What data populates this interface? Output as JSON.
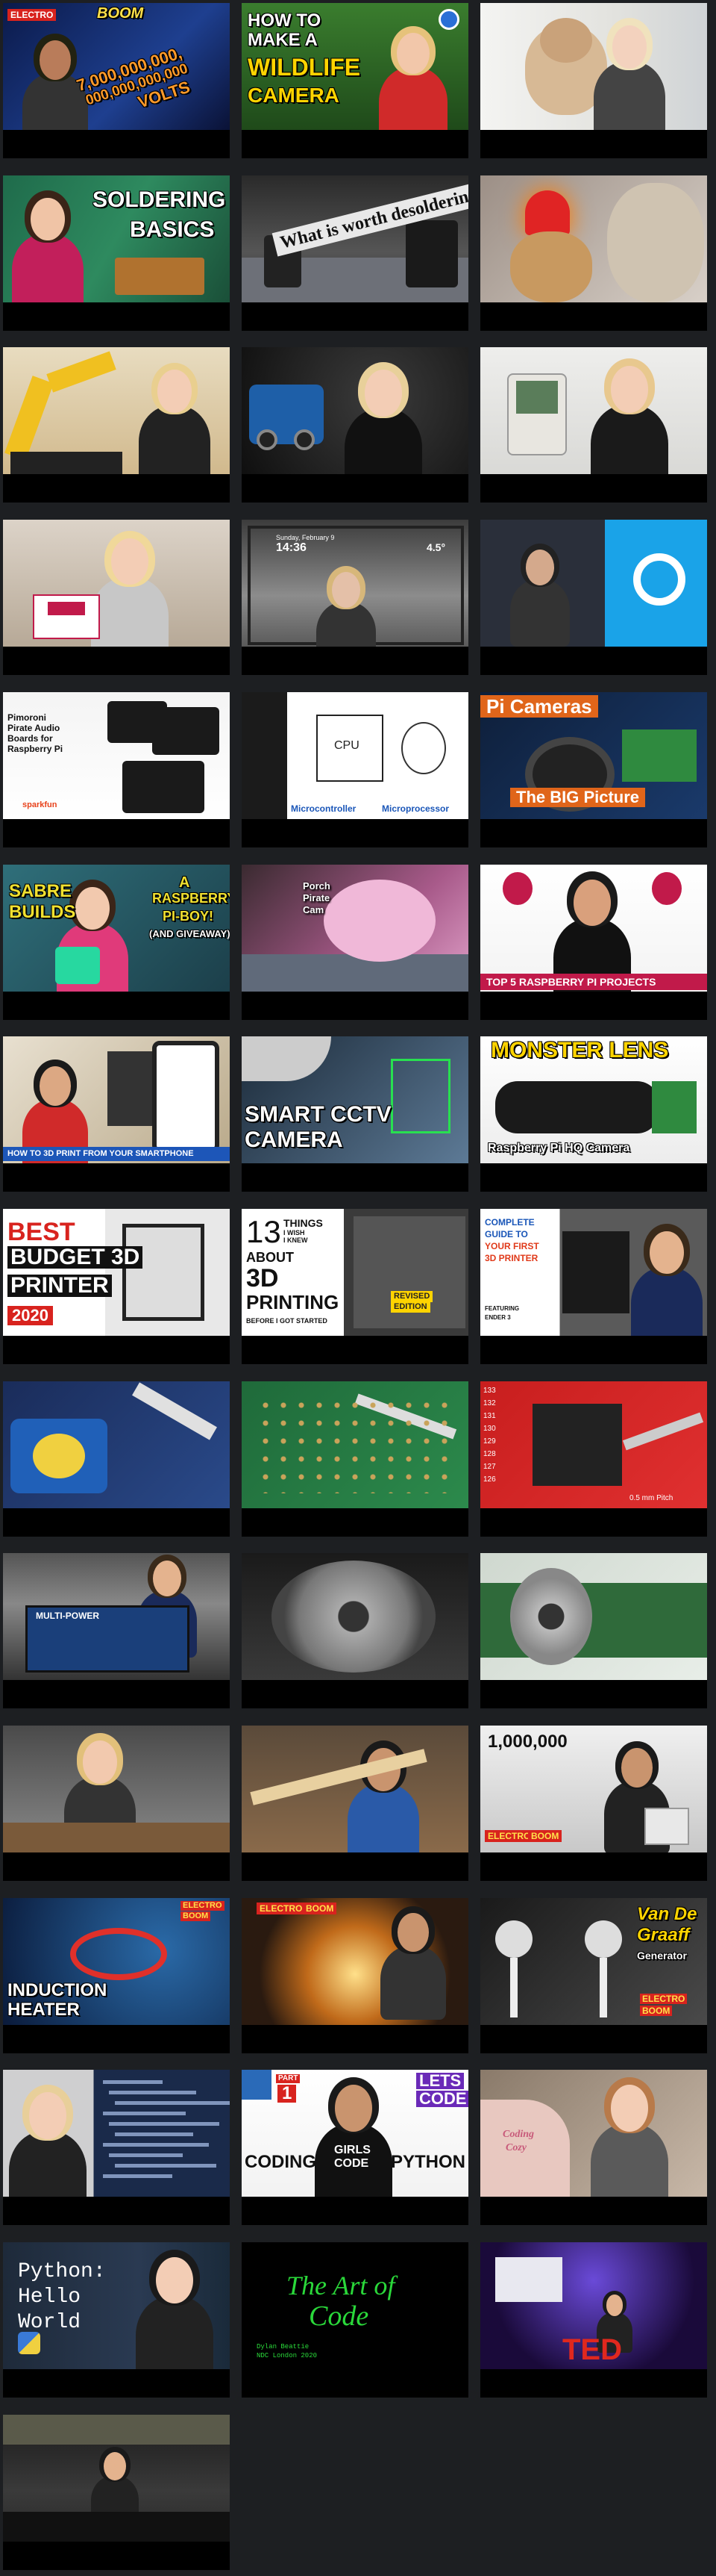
{
  "thumbnails": [
    {
      "name": "7000000000 volts",
      "lines": [
        "ELECTRO",
        "BOOM",
        "7,000,000,000,",
        "000,000,000,000",
        "VOLTS"
      ]
    },
    {
      "name": "wildlife camera",
      "lines": [
        "HOW TO",
        "MAKE A",
        "WILDLIFE",
        "CAMERA"
      ]
    },
    {
      "name": "woman with cat",
      "lines": []
    },
    {
      "name": "soldering basics",
      "lines": [
        "SOLDERING",
        "BASICS"
      ]
    },
    {
      "name": "desoldering",
      "lines": [
        "What is worth desoldering ?"
      ]
    },
    {
      "name": "alarm cat",
      "lines": []
    },
    {
      "name": "robot arm",
      "lines": []
    },
    {
      "name": "robot car",
      "lines": []
    },
    {
      "name": "handheld console",
      "lines": []
    },
    {
      "name": "raspberry pi box",
      "lines": []
    },
    {
      "name": "smart mirror",
      "lines": [
        "Sunday, February 9",
        "14:36",
        "4.5°"
      ]
    },
    {
      "name": "alexa",
      "lines": []
    },
    {
      "name": "pirate audio",
      "lines": [
        "Pimoroni",
        "Pirate Audio",
        "Boards for",
        "Raspberry Pi",
        "sparkfun"
      ]
    },
    {
      "name": "microcontroller vs microprocessor",
      "lines": [
        "CPU",
        "Microcontroller",
        "Microprocessor"
      ]
    },
    {
      "name": "pi cameras",
      "lines": [
        "Pi Cameras",
        "The BIG Picture"
      ]
    },
    {
      "name": "pi-boy",
      "lines": [
        "SABRE",
        "BUILDS",
        "A",
        "RASPBERRY",
        "PI-BOY!",
        "(AND GIVEAWAY)"
      ]
    },
    {
      "name": "porch pirate cam",
      "lines": [
        "Porch",
        "Pirate",
        "Cam"
      ]
    },
    {
      "name": "top 5 raspberry pi projects",
      "lines": [
        "TOP 5 RASPBERRY PI PROJECTS"
      ]
    },
    {
      "name": "3d print from smartphone",
      "lines": [
        "HOW TO 3D PRINT FROM YOUR SMARTPHONE"
      ]
    },
    {
      "name": "smart cctv camera",
      "lines": [
        "SMART CCTV",
        "CAMERA"
      ]
    },
    {
      "name": "monster lens",
      "lines": [
        "MONSTER LENS",
        "Raspberry Pi HQ Camera"
      ]
    },
    {
      "name": "best budget 3d printer",
      "lines": [
        "BEST",
        "BUDGET 3D",
        "PRINTER",
        "2020"
      ]
    },
    {
      "name": "13 things 3d printing",
      "lines": [
        "13",
        "THINGS",
        "I WISH",
        "I KNEW",
        "ABOUT",
        "3D",
        "PRINTING",
        "BEFORE I GOT STARTED",
        "REVISED",
        "EDITION"
      ]
    },
    {
      "name": "complete guide 3d printer",
      "lines": [
        "COMPLETE",
        "GUIDE TO",
        "YOUR FIRST",
        "3D PRINTER",
        "FEATURING",
        "ENDER 3"
      ]
    },
    {
      "name": "soldering iron",
      "lines": []
    },
    {
      "name": "pcb soldering",
      "lines": []
    },
    {
      "name": "smd chip",
      "lines": [
        "133",
        "132",
        "131",
        "130",
        "129",
        "128",
        "127",
        "126",
        "0.5 mm Pitch"
      ]
    },
    {
      "name": "multi-power supply",
      "lines": [
        "MULTI-POWER"
      ]
    },
    {
      "name": "hard drive platter",
      "lines": []
    },
    {
      "name": "hard drive pcb",
      "lines": []
    },
    {
      "name": "workbench",
      "lines": []
    },
    {
      "name": "wooden stick",
      "lines": []
    },
    {
      "name": "1000000 subs",
      "lines": [
        "1,000,000",
        "ELECTRO",
        "BOOM"
      ]
    },
    {
      "name": "induction heater",
      "lines": [
        "ELECTRO",
        "BOOM",
        "INDUCTION",
        "HEATER"
      ]
    },
    {
      "name": "fire experiment",
      "lines": [
        "ELECTRO",
        "BOOM"
      ]
    },
    {
      "name": "van de graaff",
      "lines": [
        "Van De",
        "Graaff",
        "Generator",
        "ELECTRO",
        "BOOM"
      ]
    },
    {
      "name": "code tutorial",
      "lines": []
    },
    {
      "name": "lets code python",
      "lines": [
        "PART",
        "1",
        "LETS",
        "CODE",
        "CODING",
        "PYTHON",
        "GIRLS",
        "CODE"
      ]
    },
    {
      "name": "coding cozy",
      "lines": [
        "Coding",
        "Cozy"
      ]
    },
    {
      "name": "python hello world",
      "lines": [
        "Python:",
        "Hello",
        "World"
      ]
    },
    {
      "name": "the art of code",
      "lines": [
        "The Art of",
        "Code",
        "Dylan Beattie",
        "NDC London 2020"
      ]
    },
    {
      "name": "tedx talk",
      "lines": [
        "TED"
      ]
    },
    {
      "name": "stage talk",
      "lines": []
    }
  ],
  "colors": {
    "page_bg": "#1d1f22",
    "card_bg": "#000000",
    "electroboom_red": "#d8231e",
    "electroboom_yellow": "#ffe14a"
  }
}
